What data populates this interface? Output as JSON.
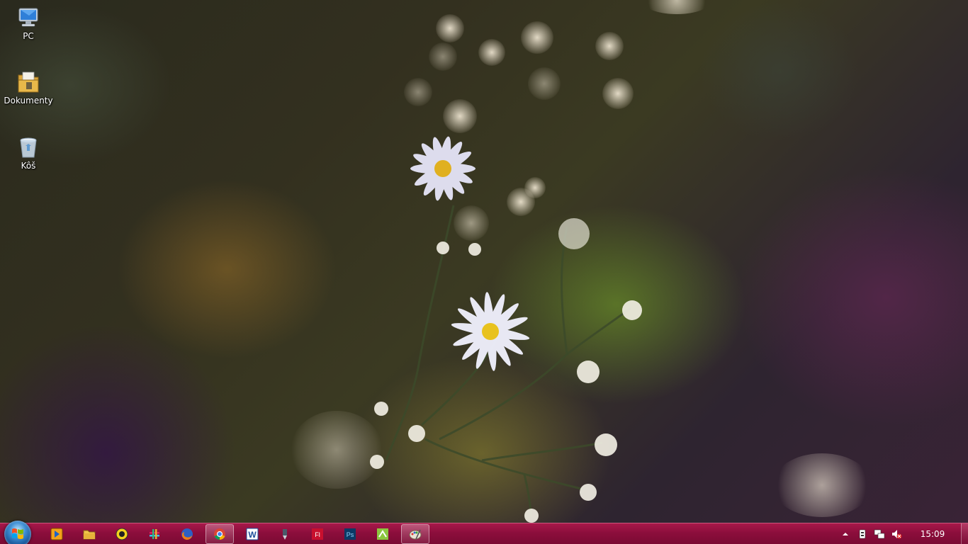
{
  "desktop": {
    "icons": [
      {
        "label": "PC",
        "icon": "computer-icon"
      },
      {
        "label": "Dokumenty",
        "icon": "documents-folder-icon"
      },
      {
        "label": "Kôš",
        "icon": "recycle-bin-icon"
      }
    ]
  },
  "taskbar": {
    "color": "#8c0e3c",
    "start": {
      "icon": "windows-logo-icon"
    },
    "apps": [
      {
        "icon": "media-player-icon",
        "active": false
      },
      {
        "icon": "file-explorer-icon",
        "active": false
      },
      {
        "icon": "yellow-avatar-icon",
        "active": false
      },
      {
        "icon": "slack-icon",
        "active": false
      },
      {
        "icon": "firefox-icon",
        "active": false
      },
      {
        "icon": "chrome-icon",
        "active": true
      },
      {
        "icon": "word-icon",
        "active": false
      },
      {
        "icon": "pen-tool-icon",
        "active": false
      },
      {
        "icon": "flash-icon",
        "active": false
      },
      {
        "icon": "photoshop-icon",
        "active": false
      },
      {
        "icon": "green-app-icon",
        "active": false
      },
      {
        "icon": "paint-icon",
        "active": true
      }
    ],
    "tray": {
      "icons": [
        "show-hidden-icons-arrow",
        "usb-device-icon",
        "network-icon",
        "volume-muted-icon"
      ],
      "clock": "15:09"
    }
  }
}
